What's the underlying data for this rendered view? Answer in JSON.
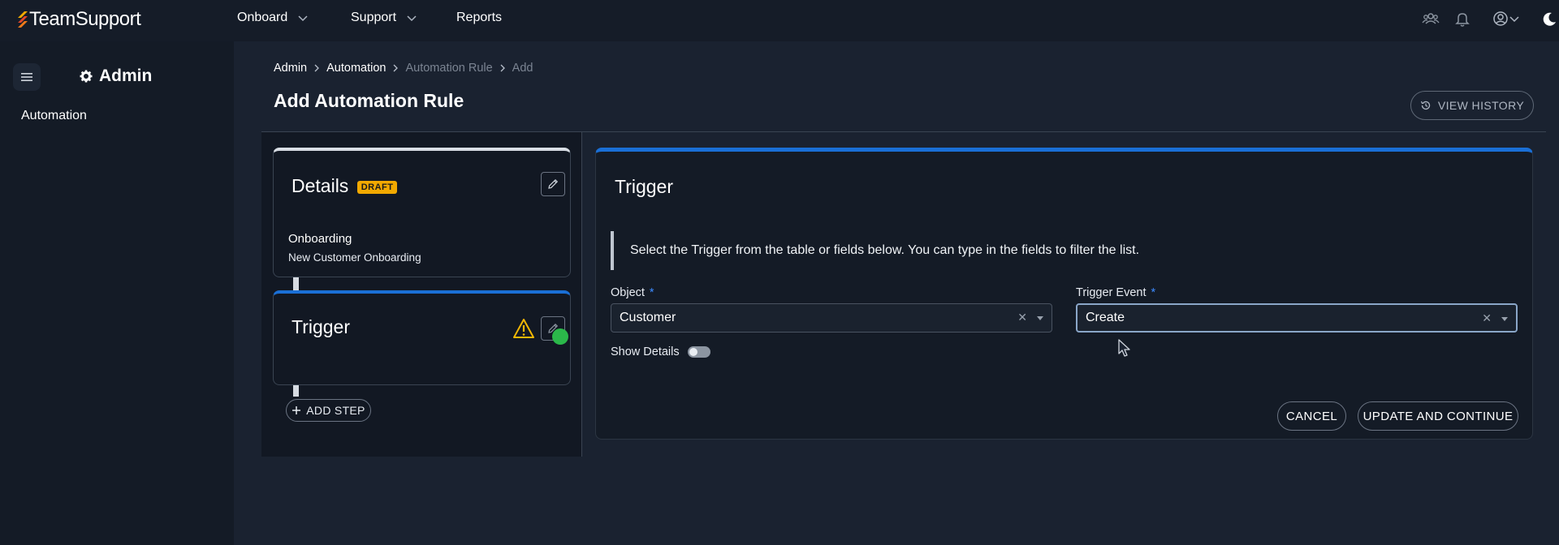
{
  "app": {
    "brand_light": "Team",
    "brand_bold": "Support"
  },
  "topnav": {
    "items": [
      {
        "label": "Onboard",
        "has_dropdown": true
      },
      {
        "label": "Support",
        "has_dropdown": true
      },
      {
        "label": "Reports",
        "has_dropdown": false
      }
    ],
    "icons": [
      "team-icon",
      "bell-icon",
      "user-account-icon",
      "moon-icon"
    ]
  },
  "sidebar": {
    "title": "Admin",
    "items": [
      {
        "label": "Automation"
      }
    ]
  },
  "breadcrumb": [
    "Admin",
    "Automation",
    "Automation Rule",
    "Add"
  ],
  "page": {
    "title": "Add Automation Rule",
    "view_history_label": "VIEW HISTORY"
  },
  "steps": {
    "details": {
      "title": "Details",
      "badge": "DRAFT",
      "category": "Onboarding",
      "name": "New Customer Onboarding"
    },
    "trigger": {
      "title": "Trigger",
      "status": "warning"
    },
    "add_step_label": "ADD STEP"
  },
  "trigger_panel": {
    "title": "Trigger",
    "info": "Select the Trigger from the table or fields below. You can type in the fields to filter the list.",
    "object_label": "Object",
    "object_value": "Customer",
    "event_label": "Trigger Event",
    "event_value": "Create",
    "show_details_label": "Show Details",
    "show_details_on": false,
    "cancel_label": "CANCEL",
    "submit_label": "UPDATE AND CONTINUE"
  },
  "colors": {
    "accent": "#1a6fd6",
    "draft_badge": "#f2a900",
    "warning": "#f2b705",
    "success_dot": "#2bb84a",
    "required": "#3d8bff"
  }
}
